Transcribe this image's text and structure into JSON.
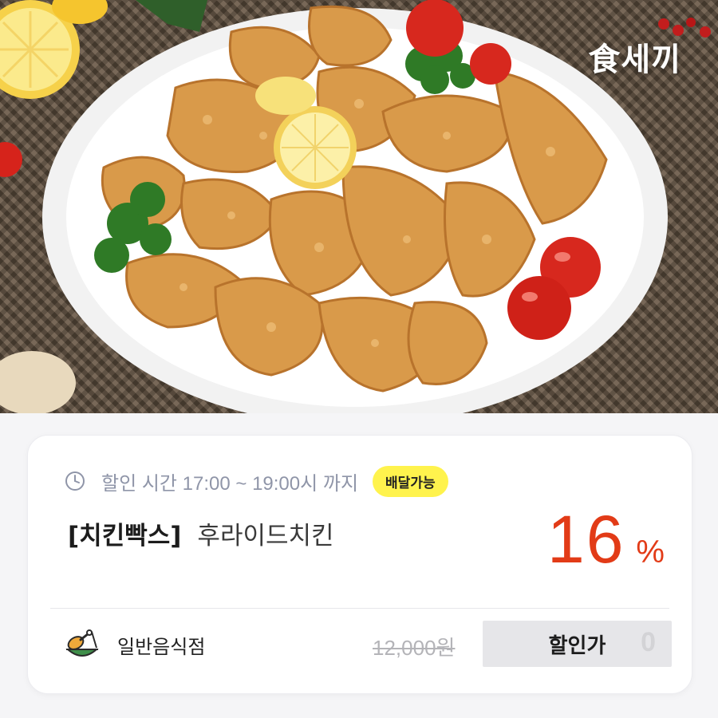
{
  "hero": {
    "image_description": "",
    "brand_logo": "食세끼"
  },
  "deal": {
    "discount_time_text": "할인 시간 17:00 ~ 19:00시 까지",
    "delivery_badge": "배달가능",
    "store_name": "[치킨빡스]",
    "menu_name": "후라이드치킨",
    "discount_value": "16",
    "discount_unit": "%",
    "category": "일반음식점",
    "original_price": "12,000원",
    "sale_price_button": "할인가"
  },
  "icons": {
    "clock": "clock-icon",
    "category": "restaurant-icon"
  },
  "colors": {
    "discount": "#e23b17",
    "badge": "#fff34d",
    "time_text": "#8f95a8",
    "button_bg": "#e6e6e9"
  }
}
